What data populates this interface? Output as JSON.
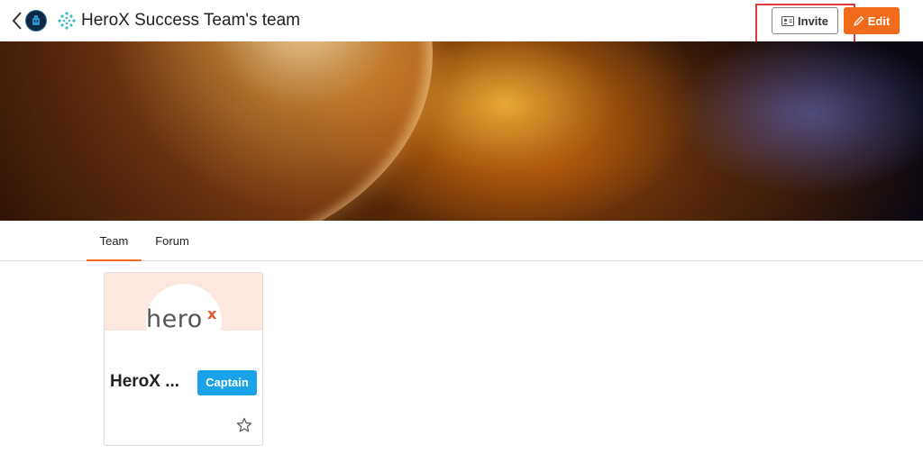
{
  "header": {
    "title": "HeroX Success Team's team",
    "invite_label": "Invite",
    "edit_label": "Edit",
    "accent_color": "#f26a1b",
    "highlight_color": "#e23a3a"
  },
  "tabs": [
    {
      "label": "Team",
      "active": true
    },
    {
      "label": "Forum",
      "active": false
    }
  ],
  "members": [
    {
      "name": "HeroX ...",
      "role_badge": "Captain",
      "logo_text": "hero",
      "logo_accent": "x",
      "badge_color": "#1aa3e8"
    }
  ],
  "icons": {
    "back": "chevron-left-icon",
    "team_avatar": "robot-icon",
    "team_logo": "dots-logo-icon",
    "invite": "contact-card-icon",
    "edit": "pencil-icon",
    "favorite": "star-icon"
  }
}
